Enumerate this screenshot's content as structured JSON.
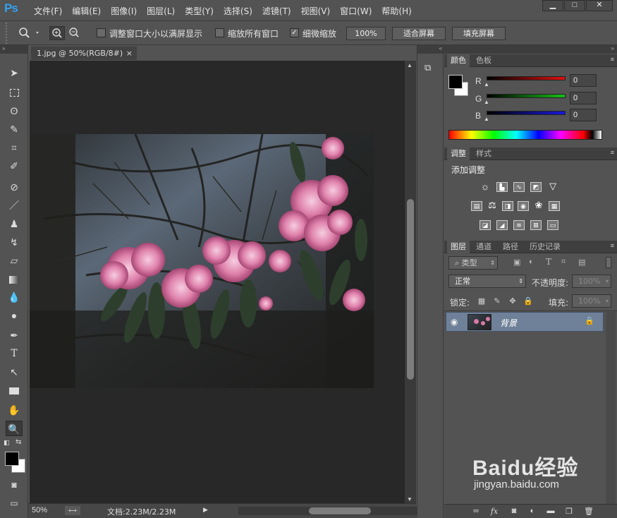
{
  "app": {
    "logo": "Ps"
  },
  "menu": [
    "文件(F)",
    "编辑(E)",
    "图像(I)",
    "图层(L)",
    "类型(Y)",
    "选择(S)",
    "滤镜(T)",
    "视图(V)",
    "窗口(W)",
    "帮助(H)"
  ],
  "window_controls": {
    "minimize": "▁",
    "maximize": "□",
    "close": "✕"
  },
  "options": {
    "zoom_icon": "magnifier-icon",
    "resize_windows_label": "调整窗口大小以满屏显示",
    "zoom_all_label": "缩放所有窗口",
    "scrubby_zoom_label": "细微缩放",
    "scrubby_checked": true,
    "btn_100": "100%",
    "btn_fit": "适合屏幕",
    "btn_fill": "填充屏幕"
  },
  "document": {
    "tab_title": "1.jpg @ 50%(RGB/8#)",
    "tab_close": "×",
    "zoom": "50%",
    "doc_info": "文档:2.23M/2.23M"
  },
  "color_panel": {
    "tabs": [
      "颜色",
      "色板"
    ],
    "channels": [
      {
        "label": "R",
        "value": "0",
        "color": "#c01010"
      },
      {
        "label": "G",
        "value": "0",
        "color": "#10b010"
      },
      {
        "label": "B",
        "value": "0",
        "color": "#1010d0"
      }
    ]
  },
  "adjust_panel": {
    "tabs": [
      "调整",
      "样式"
    ],
    "heading": "添加调整"
  },
  "layers_panel": {
    "tabs": [
      "图层",
      "通道",
      "路径",
      "历史记录"
    ],
    "kind_filter": "类型",
    "blend_mode": "正常",
    "opacity_label": "不透明度:",
    "opacity_value": "100%",
    "lock_label": "锁定:",
    "fill_label": "填充:",
    "fill_value": "100%",
    "layers": [
      {
        "name": "背景",
        "visible": true,
        "locked": true
      }
    ]
  },
  "watermark": {
    "brand": "Baidu经验",
    "url": "jingyan.baidu.com"
  }
}
